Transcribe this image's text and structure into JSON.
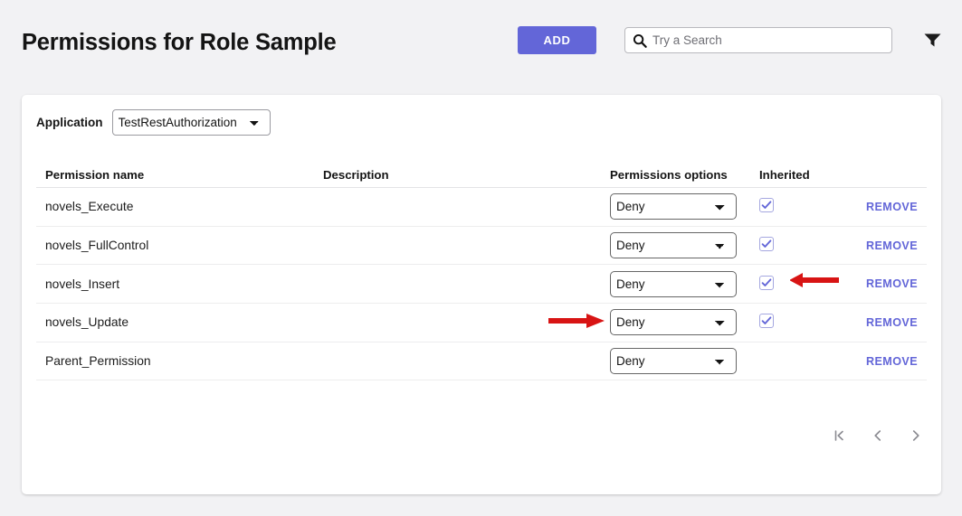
{
  "header": {
    "title": "Permissions for Role Sample",
    "add_label": "ADD",
    "search_placeholder": "Try a Search",
    "search_value": "",
    "search_icon": "search-icon",
    "filter_icon": "filter-funnel-icon"
  },
  "application": {
    "label": "Application",
    "selected": "TestRestAuthorization",
    "options": [
      "TestRestAuthorization"
    ]
  },
  "table": {
    "columns": [
      "Permission name",
      "Description",
      "Permissions options",
      "Inherited",
      ""
    ],
    "rows": [
      {
        "name": "novels_Execute",
        "description": "",
        "option": "Deny",
        "inherited": true,
        "action": "REMOVE"
      },
      {
        "name": "novels_FullControl",
        "description": "",
        "option": "Deny",
        "inherited": true,
        "action": "REMOVE"
      },
      {
        "name": "novels_Insert",
        "description": "",
        "option": "Deny",
        "inherited": true,
        "action": "REMOVE"
      },
      {
        "name": "novels_Update",
        "description": "",
        "option": "Deny",
        "inherited": true,
        "action": "REMOVE"
      },
      {
        "name": "Parent_Permission",
        "description": "",
        "option": "Deny",
        "inherited": false,
        "action": "REMOVE"
      }
    ],
    "option_choices": [
      "Deny"
    ]
  },
  "pagination": {
    "first_icon": "first-page-icon",
    "prev_icon": "chevron-left-icon",
    "next_icon": "chevron-right-icon"
  },
  "annotations": [
    {
      "name": "arrow-pointing-to-update-option",
      "direction": "right",
      "color": "#d81414"
    },
    {
      "name": "arrow-pointing-to-insert-inherited",
      "direction": "left",
      "color": "#d81414"
    }
  ],
  "colors": {
    "accent": "#6366d8",
    "page_bg": "#f2f2f4",
    "card_bg": "#ffffff",
    "annotation": "#d81414"
  }
}
